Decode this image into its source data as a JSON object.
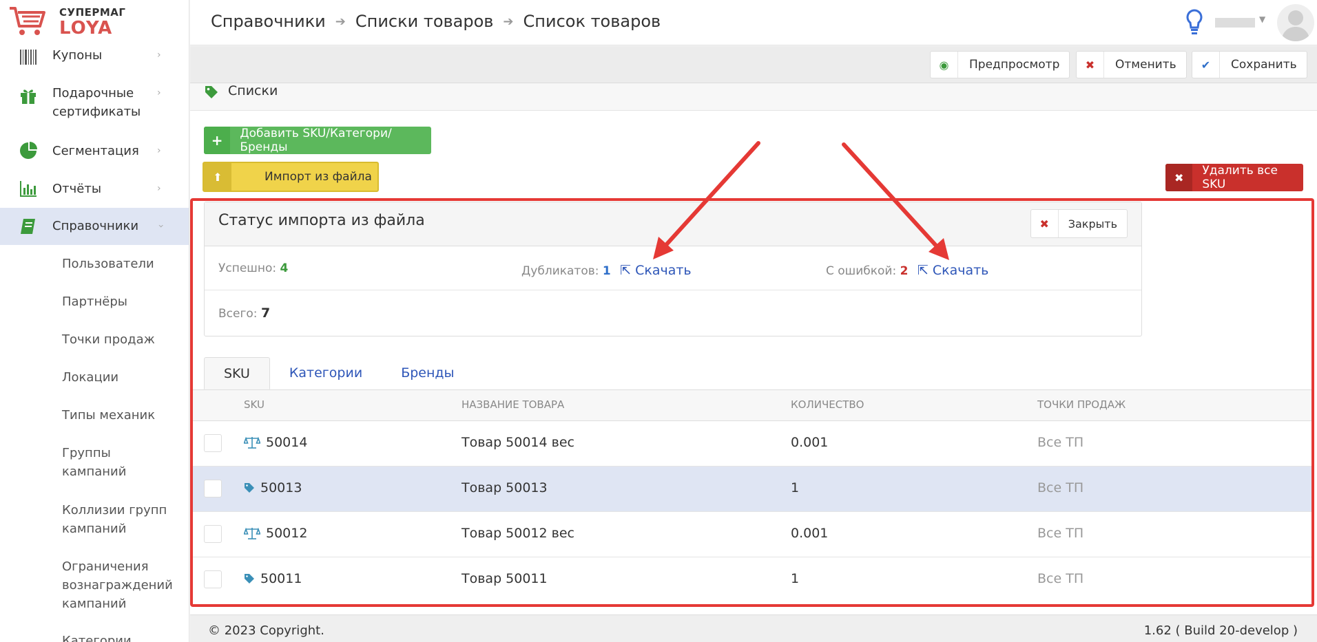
{
  "brand": {
    "top": "СУПЕРМАГ",
    "main": "LOYA",
    "color": "#d9534f"
  },
  "sidebar": {
    "items": [
      {
        "label": "Купоны",
        "icon": "barcode-icon"
      },
      {
        "label": "Подарочные",
        "label2": "сертификаты",
        "icon": "gift-icon"
      },
      {
        "label": "Сегментация",
        "icon": "pie-chart-icon"
      },
      {
        "label": "Отчёты",
        "icon": "bar-chart-icon"
      },
      {
        "label": "Справочники",
        "icon": "book-icon",
        "active": true
      }
    ],
    "subitems": [
      "Пользователи",
      "Партнёры",
      "Точки продаж",
      "Локации",
      "Типы механик",
      [
        "Группы",
        "кампаний"
      ],
      [
        "Коллизии групп",
        "кампаний"
      ],
      [
        "Ограничения",
        "вознаграждений",
        "кампаний"
      ],
      "Категории"
    ]
  },
  "breadcrumb": [
    "Справочники",
    "Списки товаров",
    "Список товаров"
  ],
  "toolbar": {
    "preview_label": "Предпросмотр",
    "cancel_label": "Отменить",
    "save_label": "Сохранить"
  },
  "section": {
    "title": "Списки"
  },
  "buttons": {
    "add_label": "Добавить SKU/Категори/Бренды",
    "import_label": "Импорт из файла",
    "delete_all_label": "Удалить все SKU"
  },
  "import_status": {
    "title": "Статус импорта из файла",
    "close_label": "Закрыть",
    "success_label": "Успешно:",
    "success_count": "4",
    "duplicates_label": "Дубликатов:",
    "duplicates_count": "1",
    "errors_label": "С ошибкой:",
    "errors_count": "2",
    "download_label": "Скачать",
    "total_label": "Всего:",
    "total_count": "7"
  },
  "tabs": [
    "SKU",
    "Категории",
    "Бренды"
  ],
  "table": {
    "headers": [
      "SKU",
      "Название товара",
      "Количество",
      "Точки продаж"
    ],
    "rows": [
      {
        "icon": "scale-icon",
        "sku": "50014",
        "name": "Товар 50014 вес",
        "qty": "0.001",
        "tp": "Все ТП"
      },
      {
        "icon": "tag-icon",
        "sku": "50013",
        "name": "Товар 50013",
        "qty": "1",
        "tp": "Все ТП"
      },
      {
        "icon": "scale-icon",
        "sku": "50012",
        "name": "Товар 50012 вес",
        "qty": "0.001",
        "tp": "Все ТП"
      },
      {
        "icon": "tag-icon",
        "sku": "50011",
        "name": "Товар 50011",
        "qty": "1",
        "tp": "Все ТП"
      }
    ]
  },
  "footer": {
    "copyright": "© 2023 Copyright.",
    "version": "1.62 ( Build 20-develop )"
  },
  "colors": {
    "green": "#5cb85c",
    "yellow": "#f0d34a",
    "red": "#c9302c",
    "link": "#2e56b8",
    "highlight": "#e53935",
    "active_row": "#dfe5f3"
  }
}
